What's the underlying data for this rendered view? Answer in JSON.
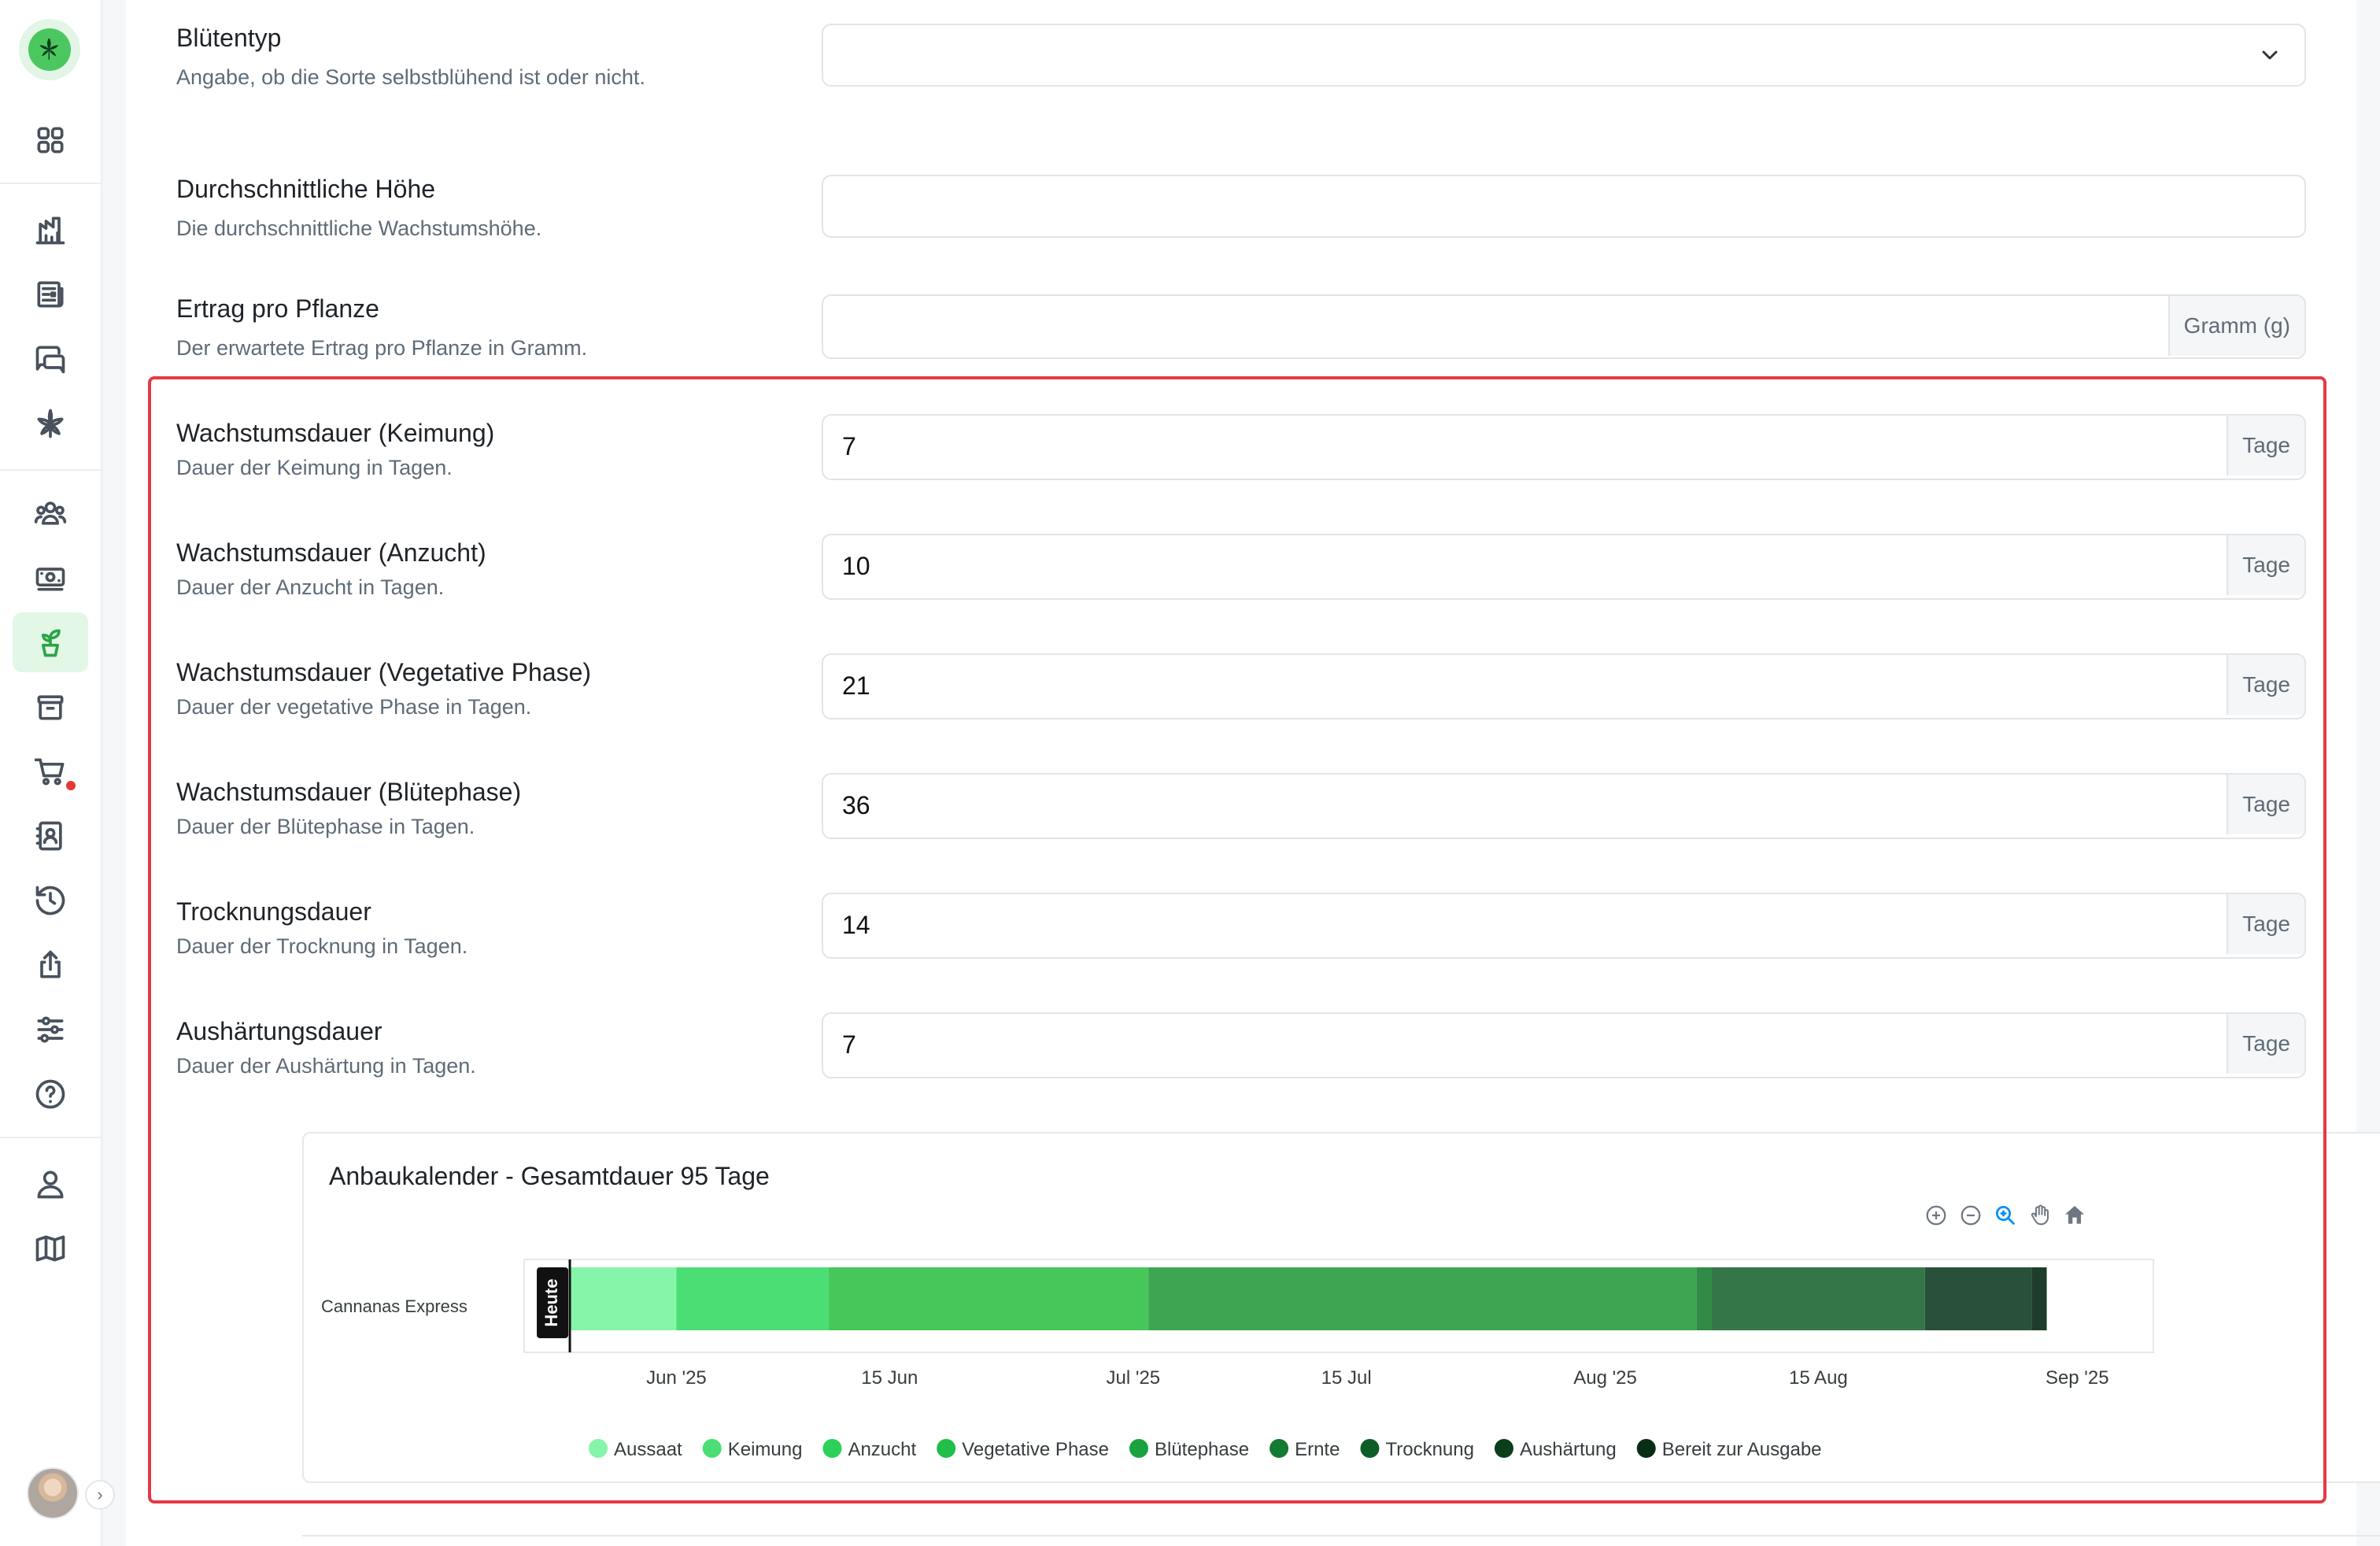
{
  "fields": [
    {
      "label": "Blütentyp",
      "desc": "Angabe, ob die Sorte selbstblühend ist oder nicht.",
      "value": "",
      "unit": ""
    },
    {
      "label": "Durchschnittliche Höhe",
      "desc": "Die durchschnittliche Wachstumshöhe.",
      "value": "",
      "unit": ""
    },
    {
      "label": "Ertrag pro Pflanze",
      "desc": "Der erwartete Ertrag pro Pflanze in Gramm.",
      "value": "",
      "unit": "Gramm (g)"
    },
    {
      "label": "Wachstumsdauer (Keimung)",
      "desc": "Dauer der Keimung in Tagen.",
      "value": "7",
      "unit": "Tage"
    },
    {
      "label": "Wachstumsdauer (Anzucht)",
      "desc": "Dauer der Anzucht in Tagen.",
      "value": "10",
      "unit": "Tage"
    },
    {
      "label": "Wachstumsdauer (Vegetative Phase)",
      "desc": "Dauer der vegetative Phase in Tagen.",
      "value": "21",
      "unit": "Tage"
    },
    {
      "label": "Wachstumsdauer (Blütephase)",
      "desc": "Dauer der Blütephase in Tagen.",
      "value": "36",
      "unit": "Tage"
    },
    {
      "label": "Trocknungsdauer",
      "desc": "Dauer der Trocknung in Tagen.",
      "value": "14",
      "unit": "Tage"
    },
    {
      "label": "Aushärtungsdauer",
      "desc": "Dauer der Aushärtung in Tagen.",
      "value": "7",
      "unit": "Tage"
    }
  ],
  "sidebar": {
    "icons": [
      "logo-icon",
      "dashboard-icon",
      "analytics-icon",
      "news-icon",
      "chat-icon",
      "cannabis-icon",
      "members-icon",
      "finance-icon",
      "plants-icon",
      "inventory-icon",
      "cart-icon",
      "contacts-icon",
      "history-icon",
      "export-icon",
      "settings-icon",
      "help-icon",
      "profile-icon",
      "map-icon"
    ],
    "active": "plants-icon",
    "accent": "#2aa446"
  },
  "chart_data": {
    "type": "bar",
    "title": "Anbaukalender - Gesamtdauer 95 Tage",
    "category": "Cannanas Express",
    "today_label": "Heute",
    "x_ticks": [
      "Jun '25",
      "15 Jun",
      "Jul '25",
      "15 Jul",
      "Aug '25",
      "15 Aug",
      "Sep '25"
    ],
    "phases": [
      {
        "name": "Aussaat",
        "start": "2025-05-25",
        "end": "2025-06-01",
        "color": "#86f5a9"
      },
      {
        "name": "Keimung",
        "start": "2025-06-01",
        "end": "2025-06-11",
        "color": "#4ade74"
      },
      {
        "name": "Anzucht",
        "start": "2025-06-11",
        "end": "2025-07-02",
        "color": "#47c65a"
      },
      {
        "name": "Vegetative Phase",
        "start": "2025-07-02",
        "end": "2025-08-07",
        "color": "#3ea553"
      },
      {
        "name": "Blütephase",
        "start": "2025-08-07",
        "end": "2025-08-08",
        "color": "#2f8b45"
      },
      {
        "name": "Ernte",
        "start": "2025-08-08",
        "end": "2025-08-22",
        "color": "#357649"
      },
      {
        "name": "Trocknung",
        "start": "2025-08-22",
        "end": "2025-08-29",
        "color": "#28503a"
      },
      {
        "name": "Aushärtung",
        "start": "2025-08-29",
        "end": "2025-08-30",
        "color": "#1e3d2a"
      }
    ],
    "legend": [
      {
        "name": "Aussaat",
        "color": "#86f5a9"
      },
      {
        "name": "Keimung",
        "color": "#4ade74"
      },
      {
        "name": "Anzucht",
        "color": "#2dd15a"
      },
      {
        "name": "Vegetative Phase",
        "color": "#1fbf4a"
      },
      {
        "name": "Blütephase",
        "color": "#1aa240"
      },
      {
        "name": "Ernte",
        "color": "#137a31"
      },
      {
        "name": "Trocknung",
        "color": "#0e5d27"
      },
      {
        "name": "Aushärtung",
        "color": "#0b3e1d"
      },
      {
        "name": "Bereit zur Ausgabe",
        "color": "#082e15"
      }
    ]
  },
  "toolbar": {
    "icons": [
      "zoom-in-icon",
      "zoom-out-icon",
      "zoom-select-icon",
      "pan-icon",
      "reset-home-icon"
    ]
  }
}
